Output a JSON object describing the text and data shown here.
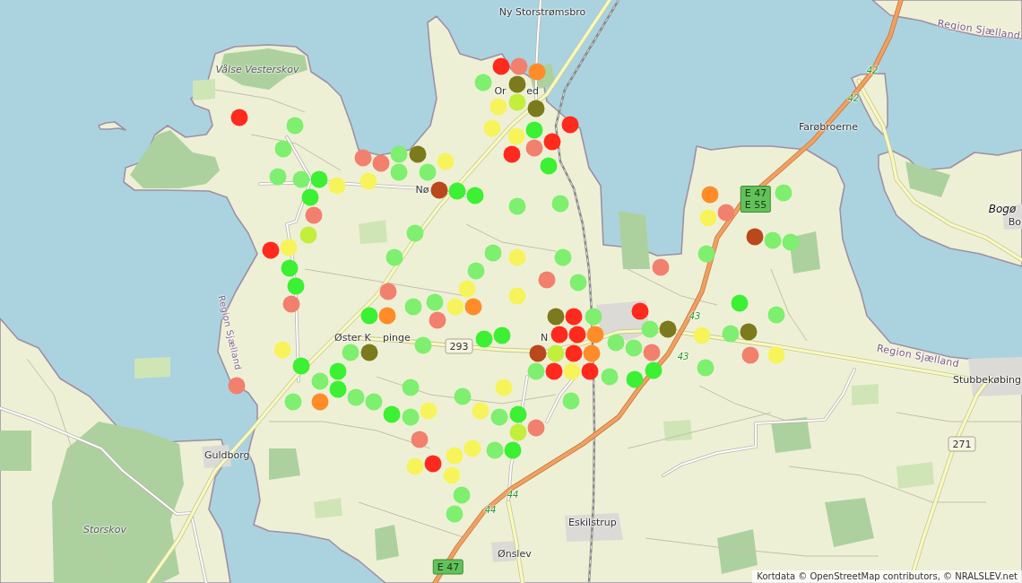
{
  "map": {
    "labels": [
      {
        "text": "Ny Storstrømsbro",
        "kind": "place"
      },
      {
        "text": "Region Sjælland",
        "kind": "region"
      },
      {
        "text": "Vålse Vesterskov",
        "kind": "area"
      },
      {
        "text": "Or",
        "kind": "place"
      },
      {
        "text": "ed",
        "kind": "place"
      },
      {
        "text": "Farøbroerne",
        "kind": "place"
      },
      {
        "text": "Nø",
        "kind": "place"
      },
      {
        "text": "Bogø",
        "kind": "island"
      },
      {
        "text": "Bo",
        "kind": "place"
      },
      {
        "text": "Øster K",
        "kind": "place"
      },
      {
        "text": "pinge",
        "kind": "place"
      },
      {
        "text": "N",
        "kind": "place"
      },
      {
        "text": "Region Sjælland",
        "kind": "region"
      },
      {
        "text": "Region Sjælland",
        "kind": "region"
      },
      {
        "text": "Stubbekøbing",
        "kind": "place"
      },
      {
        "text": "Guldborg",
        "kind": "place"
      },
      {
        "text": "Eskilstrup",
        "kind": "place"
      },
      {
        "text": "Storskov",
        "kind": "area"
      },
      {
        "text": "Ønslev",
        "kind": "place"
      }
    ],
    "road_shields": [
      {
        "kind": "route",
        "lines": [
          "42"
        ]
      },
      {
        "kind": "route",
        "lines": [
          "42"
        ]
      },
      {
        "kind": "highway",
        "lines": [
          "E 47",
          "E 55"
        ]
      },
      {
        "kind": "route",
        "lines": [
          "43"
        ]
      },
      {
        "kind": "national",
        "lines": [
          "293"
        ]
      },
      {
        "kind": "route",
        "lines": [
          "43"
        ]
      },
      {
        "kind": "national",
        "lines": [
          "271"
        ]
      },
      {
        "kind": "route",
        "lines": [
          "44"
        ]
      },
      {
        "kind": "route",
        "lines": [
          "44"
        ]
      },
      {
        "kind": "highway",
        "lines": [
          "E 47"
        ]
      }
    ],
    "markers": [
      {
        "color": "#ff2a1e"
      },
      {
        "color": "#7eef6e"
      },
      {
        "color": "#7eef6e"
      },
      {
        "color": "#7eef6e"
      },
      {
        "color": "#7eef6e"
      },
      {
        "color": "#3cf034"
      },
      {
        "color": "#f6f45a"
      },
      {
        "color": "#3cf034"
      },
      {
        "color": "#f2806e"
      },
      {
        "color": "#c2ee3c"
      },
      {
        "color": "#ff2a1e"
      },
      {
        "color": "#f6f45a"
      },
      {
        "color": "#3cf034"
      },
      {
        "color": "#3cf034"
      },
      {
        "color": "#f2806e"
      },
      {
        "color": "#f6f45a"
      },
      {
        "color": "#3cf034"
      },
      {
        "color": "#f2806e"
      },
      {
        "color": "#7eef6e"
      },
      {
        "color": "#7eef6e"
      },
      {
        "color": "#3cf034"
      },
      {
        "color": "#3cf034"
      },
      {
        "color": "#ff8c28"
      },
      {
        "color": "#7eef6e"
      },
      {
        "color": "#7eef6e"
      },
      {
        "color": "#3cf034"
      },
      {
        "color": "#7eef6e"
      },
      {
        "color": "#7eef6e"
      },
      {
        "color": "#f6f45a"
      },
      {
        "color": "#f2806e"
      },
      {
        "color": "#f6f45a"
      },
      {
        "color": "#ff2a1e"
      },
      {
        "color": "#f6f45a"
      },
      {
        "color": "#7eef6e"
      },
      {
        "color": "#7eef6e"
      },
      {
        "color": "#f6f45a"
      },
      {
        "color": "#f6f45a"
      },
      {
        "color": "#7eef6e"
      },
      {
        "color": "#3cf034"
      },
      {
        "color": "#7eef6e"
      },
      {
        "color": "#f6f45a"
      },
      {
        "color": "#7eef6e"
      },
      {
        "color": "#3cf034"
      },
      {
        "color": "#c2ee3c"
      },
      {
        "color": "#f2806e"
      },
      {
        "color": "#f6f45a"
      },
      {
        "color": "#f2806e"
      },
      {
        "color": "#f2806e"
      },
      {
        "color": "#f6f45a"
      },
      {
        "color": "#7eef6e"
      },
      {
        "color": "#7b7a1c"
      },
      {
        "color": "#7eef6e"
      },
      {
        "color": "#7eef6e"
      },
      {
        "color": "#f6f45a"
      },
      {
        "color": "#b9481a"
      },
      {
        "color": "#3cf034"
      },
      {
        "color": "#3cf034"
      },
      {
        "color": "#7eef6e"
      },
      {
        "color": "#7eef6e"
      },
      {
        "color": "#f2806e"
      },
      {
        "color": "#3cf034"
      },
      {
        "color": "#ff8c28"
      },
      {
        "color": "#7b7a1c"
      },
      {
        "color": "#7eef6e"
      },
      {
        "color": "#7eef6e"
      },
      {
        "color": "#7eef6e"
      },
      {
        "color": "#f2806e"
      },
      {
        "color": "#f6f45a"
      },
      {
        "color": "#ff8c28"
      },
      {
        "color": "#f6f45a"
      },
      {
        "color": "#7eef6e"
      },
      {
        "color": "#7eef6e"
      },
      {
        "color": "#f6f45a"
      },
      {
        "color": "#7eef6e"
      },
      {
        "color": "#f6f45a"
      },
      {
        "color": "#7eef6e"
      },
      {
        "color": "#3cf034"
      },
      {
        "color": "#3cf034"
      },
      {
        "color": "#ff2a1e"
      },
      {
        "color": "#f2806e"
      },
      {
        "color": "#7b7a1c"
      },
      {
        "color": "#c2ee3c"
      },
      {
        "color": "#f6f45a"
      },
      {
        "color": "#7eef6e"
      },
      {
        "color": "#ff8c28"
      },
      {
        "color": "#7b7a1c"
      },
      {
        "color": "#ff2a1e"
      },
      {
        "color": "#ff2a1e"
      },
      {
        "color": "#3cf034"
      },
      {
        "color": "#f2806e"
      },
      {
        "color": "#3cf034"
      },
      {
        "color": "#f6f45a"
      },
      {
        "color": "#f6f45a"
      },
      {
        "color": "#ff2a1e"
      },
      {
        "color": "#7eef6e"
      },
      {
        "color": "#7eef6e"
      },
      {
        "color": "#f2806e"
      },
      {
        "color": "#7eef6e"
      },
      {
        "color": "#f2806e"
      },
      {
        "color": "#7b7a1c"
      },
      {
        "color": "#ff2a1e"
      },
      {
        "color": "#7eef6e"
      },
      {
        "color": "#ff2a1e"
      },
      {
        "color": "#ff2a1e"
      },
      {
        "color": "#ff8c28"
      },
      {
        "color": "#b9481a"
      },
      {
        "color": "#c2ee3c"
      },
      {
        "color": "#ff2a1e"
      },
      {
        "color": "#ff8c28"
      },
      {
        "color": "#7eef6e"
      },
      {
        "color": "#ff2a1e"
      },
      {
        "color": "#f6f45a"
      },
      {
        "color": "#ff2a1e"
      },
      {
        "color": "#7eef6e"
      },
      {
        "color": "#7eef6e"
      },
      {
        "color": "#7eef6e"
      },
      {
        "color": "#7eef6e"
      },
      {
        "color": "#ff2a1e"
      },
      {
        "color": "#7eef6e"
      },
      {
        "color": "#7b7a1c"
      },
      {
        "color": "#f2806e"
      },
      {
        "color": "#3cf034"
      },
      {
        "color": "#3cf034"
      },
      {
        "color": "#f6f45a"
      },
      {
        "color": "#7eef6e"
      },
      {
        "color": "#7eef6e"
      },
      {
        "color": "#7b7a1c"
      },
      {
        "color": "#f2806e"
      },
      {
        "color": "#f6f45a"
      },
      {
        "color": "#7eef6e"
      },
      {
        "color": "#3cf034"
      },
      {
        "color": "#7eef6e"
      },
      {
        "color": "#f6f45a"
      },
      {
        "color": "#ff8c28"
      },
      {
        "color": "#f2806e"
      },
      {
        "color": "#7eef6e"
      },
      {
        "color": "#b9481a"
      },
      {
        "color": "#7eef6e"
      },
      {
        "color": "#7eef6e"
      }
    ]
  },
  "attribution": "Kortdata © OpenStreetMap contributors, © NRALSLEV.net"
}
